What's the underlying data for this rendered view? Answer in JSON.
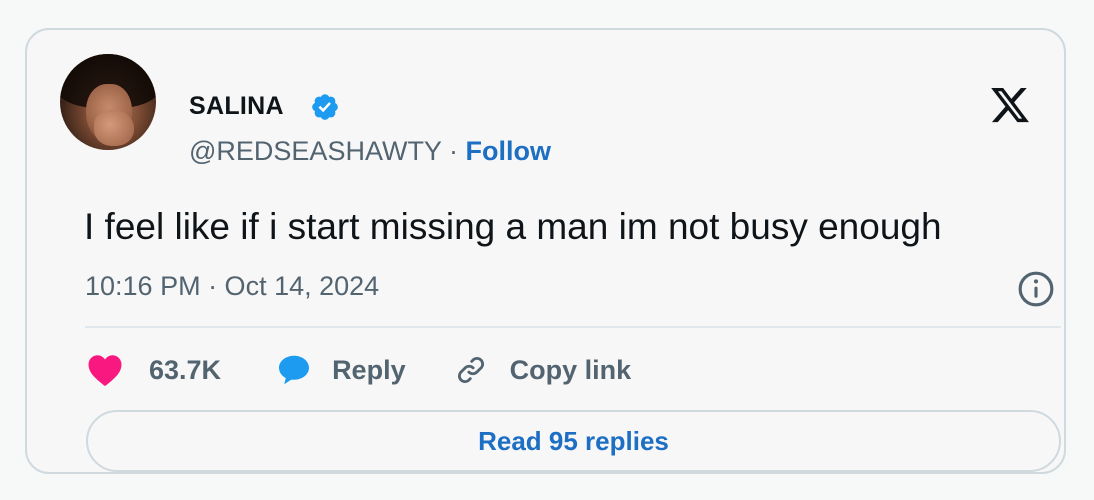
{
  "tweet": {
    "author": {
      "name": "SALINA",
      "handle": "@REDSEASHAWTY",
      "separator": "·",
      "follow_label": "Follow"
    },
    "text": "I feel like if i start missing a man im not busy enough",
    "timestamp": "10:16 PM · Oct 14, 2024",
    "actions": {
      "like_count": "63.7K",
      "reply_label": "Reply",
      "copy_link_label": "Copy link"
    },
    "read_replies_label": "Read 95 replies"
  },
  "icons": {
    "brand": "x-logo-icon",
    "verified": "verified-badge-icon",
    "info": "info-icon",
    "like": "heart-icon",
    "reply": "speech-bubble-icon",
    "copy": "link-icon"
  },
  "colors": {
    "like": "#f91880",
    "reply": "#1d9bf0",
    "verified": "#1d9bf0",
    "link": "#1d6fc4",
    "secondary_text": "#536471",
    "border": "#cfd9de"
  }
}
